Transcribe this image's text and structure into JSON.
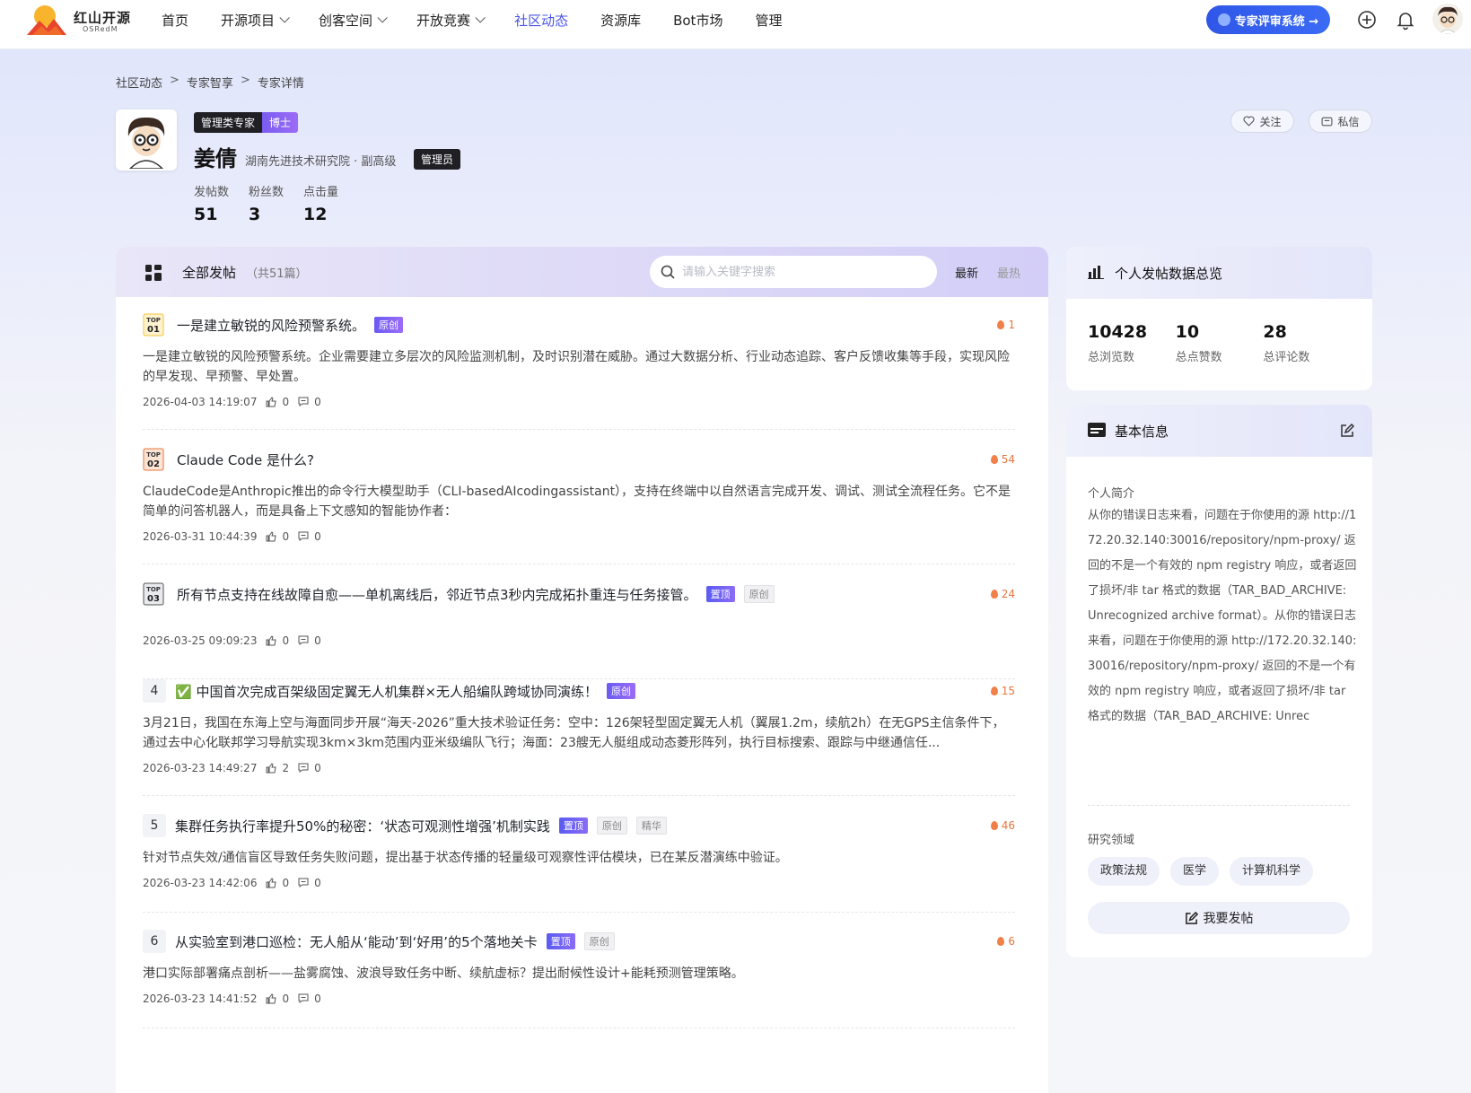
{
  "brand": {
    "name": "红山开源",
    "sub": "OSRedM"
  },
  "nav": {
    "items": [
      {
        "label": "首页",
        "dropdown": false,
        "active": false
      },
      {
        "label": "开源项目",
        "dropdown": true,
        "active": false
      },
      {
        "label": "创客空间",
        "dropdown": true,
        "active": false
      },
      {
        "label": "开放竞赛",
        "dropdown": true,
        "active": false
      },
      {
        "label": "社区动态",
        "dropdown": false,
        "active": true
      },
      {
        "label": "资源库",
        "dropdown": false,
        "active": false
      },
      {
        "label": "Bot市场",
        "dropdown": false,
        "active": false
      },
      {
        "label": "管理",
        "dropdown": false,
        "active": false
      }
    ],
    "expert_button": "专家评审系统 →"
  },
  "breadcrumb": [
    "社区动态",
    "专家智享",
    "专家详情"
  ],
  "profile": {
    "tag1": "管理类专家",
    "tag2": "博士",
    "name": "姜倩",
    "org": "湖南先进技术研究院 · 副高级",
    "role": "管理员",
    "stats": [
      {
        "label": "发帖数",
        "value": "51"
      },
      {
        "label": "粉丝数",
        "value": "3"
      },
      {
        "label": "点击量",
        "value": "12"
      }
    ],
    "follow": "关注",
    "message": "私信"
  },
  "posts_panel": {
    "title": "全部发帖",
    "count": "（共51篇）",
    "search_placeholder": "请输入关键字搜索",
    "sort_new": "最新",
    "sort_hot": "最热"
  },
  "posts": [
    {
      "rank": "TOP 01",
      "title": "一是建立敏锐的风险预警系统。",
      "badges": [
        "原创"
      ],
      "hot": "1",
      "body": "一是建立敏锐的风险预警系统。企业需要建立多层次的风险监测机制，及时识别潜在威胁。通过大数据分析、行业动态追踪、客户反馈收集等手段，实现风险的早发现、早预警、早处置。",
      "date": "2026-04-03 14:19:07",
      "likes": "0",
      "comments": "0"
    },
    {
      "rank": "TOP 02",
      "title": "Claude Code 是什么?",
      "badges": [],
      "hot": "54",
      "body": "ClaudeCode是Anthropic推出的命令行大模型助手（CLI-basedAIcodingassistant），支持在终端中以自然语言完成开发、调试、测试全流程任务。它不是简单的问答机器人，而是具备上下文感知的智能协作者：",
      "date": "2026-03-31 10:44:39",
      "likes": "0",
      "comments": "0"
    },
    {
      "rank": "TOP 03",
      "title": "所有节点支持在线故障自愈——单机离线后，邻近节点3秒内完成拓扑重连与任务接管。",
      "badges": [
        "置顶",
        "原创"
      ],
      "hot": "24",
      "body": "",
      "date": "2026-03-25 09:09:23",
      "likes": "0",
      "comments": "0"
    },
    {
      "rank": "4",
      "title": "✅ 中国首次完成百架级固定翼无人机集群×无人船编队跨域协同演练！",
      "badges": [
        "原创"
      ],
      "hot": "15",
      "body": "3月21日，我国在东海上空与海面同步开展“海天-2026”重大技术验证任务：空中：126架轻型固定翼无人机（翼展1.2m，续航2h）在无GPS主信条件下，通过去中心化联邦学习导航实现3km×3km范围内亚米级编队飞行；海面：23艘无人艇组成动态菱形阵列，执行目标搜索、跟踪与中继通信任...",
      "date": "2026-03-23 14:49:27",
      "likes": "2",
      "comments": "0"
    },
    {
      "rank": "5",
      "title": "集群任务执行率提升50%的秘密：‘状态可观测性增强’机制实践",
      "badges": [
        "置顶",
        "原创",
        "精华"
      ],
      "hot": "46",
      "body": "针对节点失效/通信盲区导致任务失败问题，提出基于状态传播的轻量级可观察性评估模块，已在某反潜演练中验证。",
      "date": "2026-03-23 14:42:06",
      "likes": "0",
      "comments": "0"
    },
    {
      "rank": "6",
      "title": "从实验室到港口巡检：无人船从‘能动’到‘好用’的5个落地关卡",
      "badges": [
        "置顶",
        "原创"
      ],
      "hot": "6",
      "body": "港口实际部署痛点剖析——盐雾腐蚀、波浪导致任务中断、续航虚标？提出耐候性设计+能耗预测管理策略。",
      "date": "2026-03-23 14:41:52",
      "likes": "0",
      "comments": "0"
    }
  ],
  "overview": {
    "title": "个人发帖数据总览",
    "items": [
      {
        "num": "10428",
        "label": "总浏览数"
      },
      {
        "num": "10",
        "label": "总点赞数"
      },
      {
        "num": "28",
        "label": "总评论数"
      }
    ]
  },
  "basic_info": {
    "title": "基本信息",
    "bio_label": "个人简介",
    "bio": "从你的错误日志来看，问题在于你使用的源 http://172.20.32.140:30016/repository/npm-proxy/ 返回的不是一个有效的 npm registry 响应，或者返回了损坏/非 tar 格式的数据（TAR_BAD_ARCHIVE: Unrecognized archive format）。从你的错误日志来看，问题在于你使用的源 http://172.20.32.140:30016/repository/npm-proxy/ 返回的不是一个有效的 npm registry 响应，或者返回了损坏/非 tar 格式的数据（TAR_BAD_ARCHIVE: Unrec",
    "field_label": "研究领域",
    "fields": [
      "政策法规",
      "医学",
      "计算机科学"
    ],
    "post_button": "我要发帖"
  },
  "colors": {
    "accent": "#4a55e6",
    "brand_blue": "#2f56e8",
    "hot": "#e8743c"
  }
}
